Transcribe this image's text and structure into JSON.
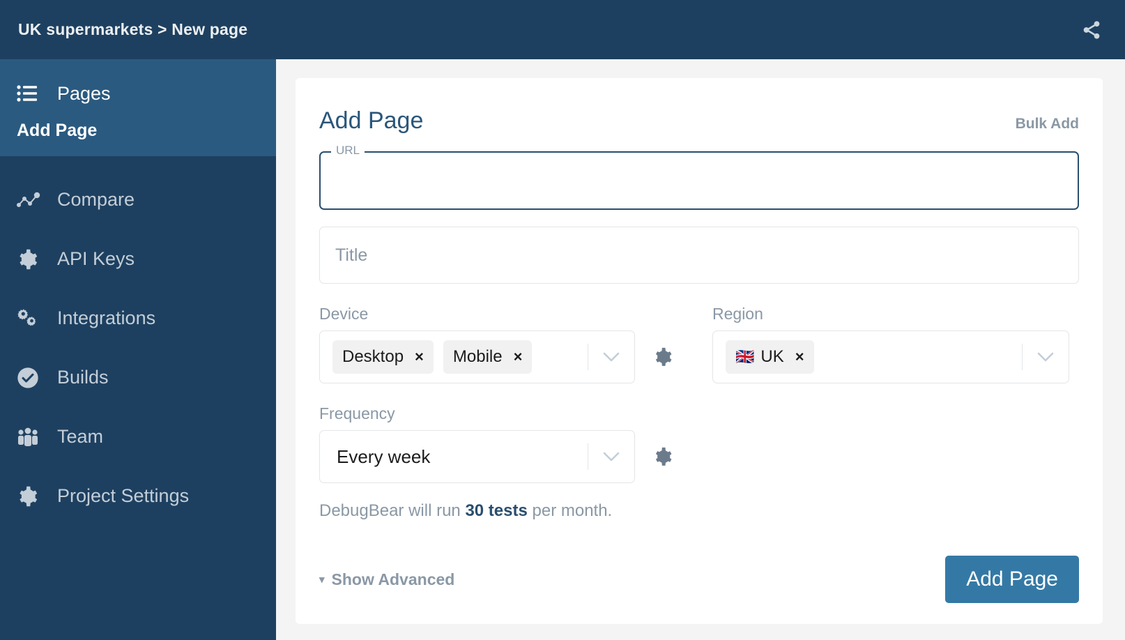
{
  "header": {
    "breadcrumb": "UK supermarkets > New page",
    "share_icon": "share-icon"
  },
  "sidebar": {
    "primary": {
      "label": "Pages",
      "icon": "list-icon"
    },
    "sub_item": {
      "label": "Add Page"
    },
    "items": [
      {
        "label": "Compare",
        "icon": "trend-dots-icon"
      },
      {
        "label": "API Keys",
        "icon": "gear-icon"
      },
      {
        "label": "Integrations",
        "icon": "gears-icon"
      },
      {
        "label": "Builds",
        "icon": "check-circle-icon"
      },
      {
        "label": "Team",
        "icon": "people-icon"
      },
      {
        "label": "Project Settings",
        "icon": "gear-icon"
      }
    ]
  },
  "main": {
    "title": "Add Page",
    "bulk_add": "Bulk Add",
    "url": {
      "legend": "URL",
      "value": ""
    },
    "title_input": {
      "placeholder": "Title",
      "value": ""
    },
    "device": {
      "label": "Device",
      "chips": [
        {
          "text": "Desktop",
          "remove": "×"
        },
        {
          "text": "Mobile",
          "remove": "×"
        }
      ],
      "caret": "chevron-down-icon",
      "settings_icon": "gear-icon"
    },
    "region": {
      "label": "Region",
      "chips": [
        {
          "flag": "🇬🇧",
          "text": "UK",
          "remove": "×"
        }
      ],
      "caret": "chevron-down-icon"
    },
    "frequency": {
      "label": "Frequency",
      "value": "Every week",
      "caret": "chevron-down-icon",
      "settings_icon": "gear-icon"
    },
    "helper": {
      "prefix": "DebugBear will run ",
      "emphasis": "30 tests",
      "suffix": " per month."
    },
    "show_advanced": {
      "triangle": "▾",
      "label": "Show Advanced"
    },
    "submit": "Add Page"
  },
  "colors": {
    "navy": "#1e4060",
    "navy_light": "#2b5a80",
    "accent": "#3479a5",
    "title": "#2a567a",
    "muted": "#8a98a5",
    "page_bg": "#f4f4f4"
  }
}
